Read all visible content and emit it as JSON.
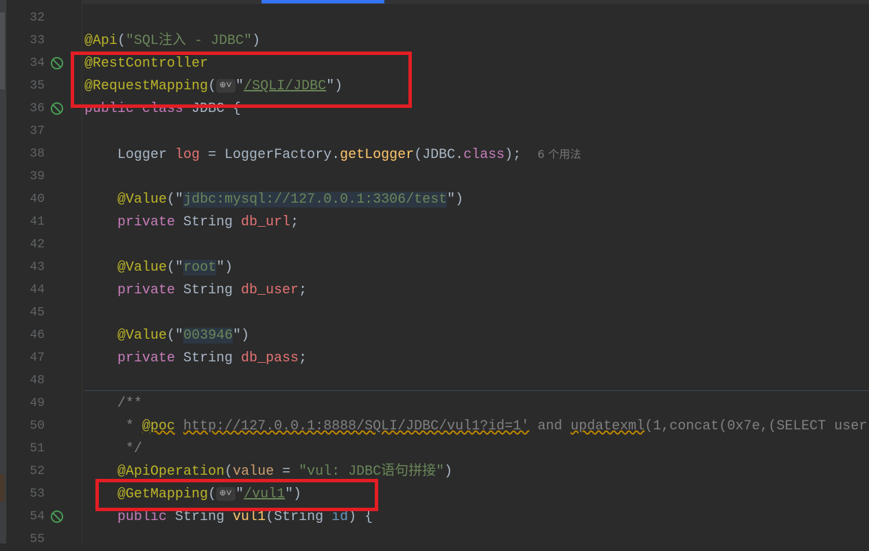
{
  "editor": {
    "lines": [
      {
        "n": "32",
        "tokens": []
      },
      {
        "n": "33",
        "tokens": [
          [
            "@Api",
            "ann"
          ],
          [
            "(",
            ""
          ],
          [
            "\"SQL注入 - JDBC\"",
            "str"
          ],
          [
            ")",
            ""
          ]
        ]
      },
      {
        "n": "34",
        "gutter": "bean-icon",
        "tokens": [
          [
            "@RestController",
            "ann"
          ]
        ]
      },
      {
        "n": "35",
        "tokens": [
          [
            "@RequestMapping",
            "ann"
          ],
          [
            "(",
            ""
          ],
          [
            "globe",
            "globe"
          ],
          [
            "\"",
            ""
          ],
          [
            "/SQLI/JDBC",
            "str uline"
          ],
          [
            "\"",
            ""
          ],
          [
            ")",
            ""
          ]
        ]
      },
      {
        "n": "36",
        "gutter": "bean-icon",
        "tokens": [
          [
            "public",
            "kw2"
          ],
          [
            " ",
            ""
          ],
          [
            "class",
            "kw2"
          ],
          [
            " JDBC {",
            ""
          ]
        ]
      },
      {
        "n": "37",
        "tokens": []
      },
      {
        "n": "38",
        "tokens": [
          [
            "    Logger ",
            ""
          ],
          [
            "log",
            "fld"
          ],
          [
            " = LoggerFactory.",
            ""
          ],
          [
            "getLogger",
            "meth"
          ],
          [
            "(JDBC.",
            ""
          ],
          [
            "class",
            "kw2"
          ],
          [
            ");  ",
            ""
          ],
          [
            "6 个用法",
            "hint"
          ]
        ]
      },
      {
        "n": "39",
        "tokens": []
      },
      {
        "n": "40",
        "tokens": [
          [
            "    ",
            ""
          ],
          [
            "@Value",
            "ann"
          ],
          [
            "(",
            ""
          ],
          [
            "\"",
            ""
          ],
          [
            "jdbc:mysql://127.0.0.1:3306/test",
            "str inj"
          ],
          [
            "\"",
            ""
          ],
          [
            ")",
            ""
          ]
        ]
      },
      {
        "n": "41",
        "tokens": [
          [
            "    ",
            ""
          ],
          [
            "private",
            "kw2"
          ],
          [
            " String ",
            ""
          ],
          [
            "db_url",
            "fld"
          ],
          [
            ";",
            ""
          ]
        ]
      },
      {
        "n": "42",
        "tokens": []
      },
      {
        "n": "43",
        "tokens": [
          [
            "    ",
            ""
          ],
          [
            "@Value",
            "ann"
          ],
          [
            "(",
            ""
          ],
          [
            "\"",
            ""
          ],
          [
            "root",
            "str inj"
          ],
          [
            "\"",
            ""
          ],
          [
            ")",
            ""
          ]
        ]
      },
      {
        "n": "44",
        "tokens": [
          [
            "    ",
            ""
          ],
          [
            "private",
            "kw2"
          ],
          [
            " String ",
            ""
          ],
          [
            "db_user",
            "fld"
          ],
          [
            ";",
            ""
          ]
        ]
      },
      {
        "n": "45",
        "tokens": []
      },
      {
        "n": "46",
        "tokens": [
          [
            "    ",
            ""
          ],
          [
            "@Value",
            "ann"
          ],
          [
            "(",
            ""
          ],
          [
            "\"",
            ""
          ],
          [
            "003946",
            "str inj"
          ],
          [
            "\"",
            ""
          ],
          [
            ")",
            ""
          ]
        ]
      },
      {
        "n": "47",
        "tokens": [
          [
            "    ",
            ""
          ],
          [
            "private",
            "kw2"
          ],
          [
            " String ",
            ""
          ],
          [
            "db_pass",
            "fld"
          ],
          [
            ";",
            ""
          ]
        ]
      },
      {
        "n": "48",
        "tokens": []
      },
      {
        "n": "49",
        "tokens": [
          [
            "    /**",
            "cmt"
          ]
        ]
      },
      {
        "n": "50",
        "tokens": [
          [
            "     * ",
            "cmt"
          ],
          [
            "@poc",
            "tag"
          ],
          [
            " ",
            "cmt"
          ],
          [
            "http://127.0.0.1:8888/SQLI/JDBC/vul1?id=1'",
            "url"
          ],
          [
            " and ",
            "cmt"
          ],
          [
            "updatexml",
            "url"
          ],
          [
            "(1,concat(0x7e,(SELECT user",
            "cmt"
          ]
        ]
      },
      {
        "n": "51",
        "tokens": [
          [
            "     */",
            "cmt"
          ]
        ]
      },
      {
        "n": "52",
        "tokens": [
          [
            "    ",
            ""
          ],
          [
            "@ApiOperation",
            "ann"
          ],
          [
            "(",
            ""
          ],
          [
            "value",
            "par"
          ],
          [
            " = ",
            ""
          ],
          [
            "\"vul: JDBC语句拼接\"",
            "str"
          ],
          [
            ")",
            ""
          ]
        ]
      },
      {
        "n": "53",
        "tokens": [
          [
            "    ",
            ""
          ],
          [
            "@GetMapping",
            "ann"
          ],
          [
            "(",
            ""
          ],
          [
            "globe",
            "globe"
          ],
          [
            "\"",
            ""
          ],
          [
            "/vul1",
            "str uline"
          ],
          [
            "\"",
            ""
          ],
          [
            ")",
            ""
          ]
        ]
      },
      {
        "n": "54",
        "gutter": "web-endpoint-icon",
        "tokens": [
          [
            "    ",
            ""
          ],
          [
            "public",
            "kw2"
          ],
          [
            " String ",
            ""
          ],
          [
            "vul1",
            "meth"
          ],
          [
            "(String ",
            ""
          ],
          [
            "id",
            "prm"
          ],
          [
            ") {",
            ""
          ]
        ]
      },
      {
        "n": "55",
        "tokens": []
      }
    ]
  }
}
